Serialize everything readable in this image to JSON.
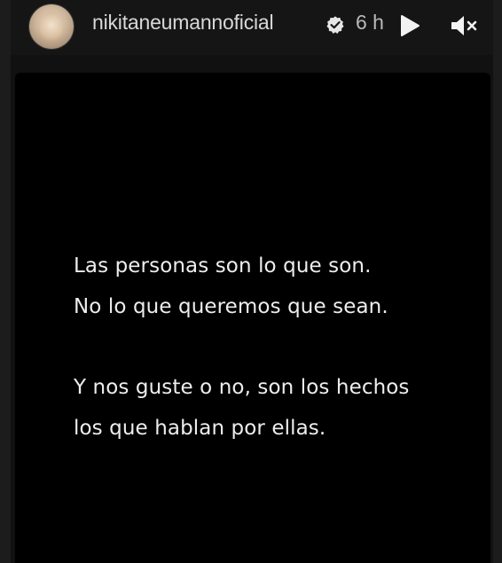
{
  "header": {
    "username": "nikitaneumannoficial",
    "timestamp": "6 h",
    "icons": {
      "avatar": "profile-avatar",
      "verified": "verified-badge-icon",
      "play": "play-icon",
      "mute": "muted-speaker-icon"
    }
  },
  "story": {
    "lines": [
      "Las personas son lo que son.",
      "No lo que queremos que sean.",
      "Y nos guste o no, son los hechos",
      "los que hablan por ellas."
    ]
  },
  "colors": {
    "background": "#000000",
    "text": "#ededed",
    "header_text": "#d8d8d8"
  }
}
